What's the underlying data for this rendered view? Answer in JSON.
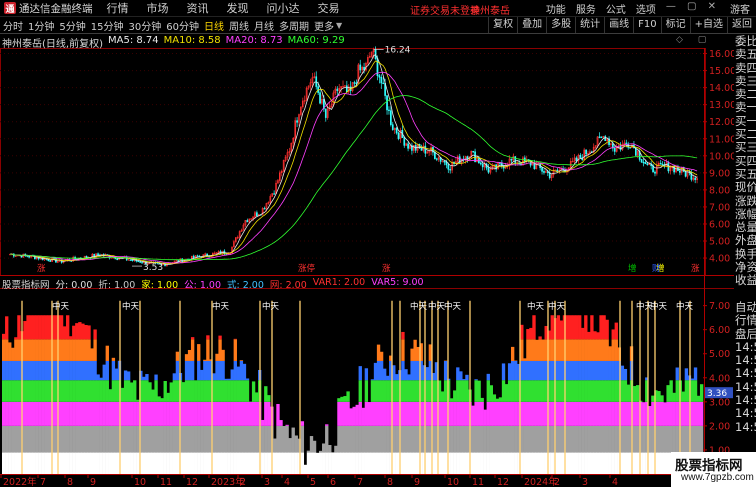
{
  "app": {
    "name": "通达信金融终端",
    "logo_char": "通"
  },
  "menu": [
    "行情",
    "市场",
    "资讯",
    "发现",
    "问小达",
    "交易"
  ],
  "title_notice": {
    "text": "证券交易未登录",
    "stock": "神州泰岳",
    "color": "#ff3030"
  },
  "title_right": [
    "功能",
    "服务",
    "公式",
    "选项"
  ],
  "guest": "游客",
  "period_tabs": [
    {
      "label": "分时",
      "active": false
    },
    {
      "label": "1分钟",
      "active": false
    },
    {
      "label": "5分钟",
      "active": false
    },
    {
      "label": "15分钟",
      "active": false
    },
    {
      "label": "30分钟",
      "active": false
    },
    {
      "label": "60分钟",
      "active": false
    },
    {
      "label": "日线",
      "active": true
    },
    {
      "label": "周线",
      "active": false
    },
    {
      "label": "月线",
      "active": false
    },
    {
      "label": "多周期",
      "active": false
    },
    {
      "label": "更多",
      "active": false
    }
  ],
  "right_tools": [
    "复权",
    "叠加",
    "多股",
    "统计",
    "画线",
    "F10",
    "标记",
    "+自选",
    "返回"
  ],
  "stock_title": "神州泰岳(日线,前复权)",
  "ma": [
    {
      "label": "MA5: 8.74",
      "color": "#e8e8e8"
    },
    {
      "label": "MA10: 8.58",
      "color": "#f0e000"
    },
    {
      "label": "MA20: 8.73",
      "color": "#ff40ff"
    },
    {
      "label": "MA60: 9.29",
      "color": "#30ff30"
    }
  ],
  "y_axis": [
    "16.00",
    "15.00",
    "14.00",
    "13.00",
    "12.00",
    "11.00",
    "10.00",
    "9.00",
    "8.00",
    "7.00",
    "6.00",
    "5.00",
    "4.00"
  ],
  "annotations": {
    "high": "16.24",
    "low": "3.53"
  },
  "event_tags": [
    {
      "text": "涨",
      "color": "#ff3030"
    },
    {
      "text": "涨停",
      "color": "#ff3030"
    },
    {
      "text": "涨",
      "color": "#ff3030"
    },
    {
      "text": "增",
      "color": "#ffff00"
    },
    {
      "text": "增",
      "color": "#00c000"
    },
    {
      "text": "财",
      "color": "#3060ff"
    },
    {
      "text": "涨",
      "color": "#ff3030"
    }
  ],
  "indicator": {
    "name": "股票指标网",
    "params": [
      {
        "label": "分: 0.00",
        "color": "#e0e0e0"
      },
      {
        "label": "折: 1.00",
        "color": "#c8c8c8"
      },
      {
        "label": "家: 1.00",
        "color": "#ffff00"
      },
      {
        "label": "公: 1.00",
        "color": "#ff40ff"
      },
      {
        "label": "式: 2.00",
        "color": "#40c0ff"
      },
      {
        "label": "网: 2.00",
        "color": "#ff3030"
      },
      {
        "label": "VAR1: 2.00",
        "color": "#ff3030"
      },
      {
        "label": "VAR5: 9.00",
        "color": "#ff40ff"
      }
    ],
    "y_axis": [
      "7.00",
      "6.00",
      "5.00",
      "4.00",
      "3.00",
      "2.00",
      "1.00"
    ],
    "current_value": "3.36",
    "tag": "中天"
  },
  "x_axis": [
    "2022年",
    "7",
    "8",
    "9",
    "10",
    "11",
    "12",
    "2023年",
    "2",
    "3",
    "4",
    "5",
    "6",
    "7",
    "8",
    "9",
    "10",
    "11",
    "12",
    "2024年",
    "2",
    "3",
    "4"
  ],
  "right_panel": [
    "委比",
    "卖五",
    "卖四",
    "卖三",
    "卖二",
    "卖一",
    "买一",
    "买二",
    "买三",
    "买四",
    "买五",
    "现价",
    "涨跌",
    "涨幅",
    "总量",
    "外盘",
    "换手",
    "净资",
    "收益",
    "",
    "自动",
    "行情",
    "盘后",
    "14:56",
    "14:56",
    "14:56",
    "14:56",
    "14:56",
    "14:56",
    "14:56"
  ],
  "watermark": {
    "line1": "股票指标网",
    "line2": "www.7gpzb.com"
  },
  "colors": {
    "up": "#ff3030",
    "down": "#30ffff",
    "grid": "#3a0000",
    "axis": "#b00000",
    "accent": "#ffd800"
  }
}
